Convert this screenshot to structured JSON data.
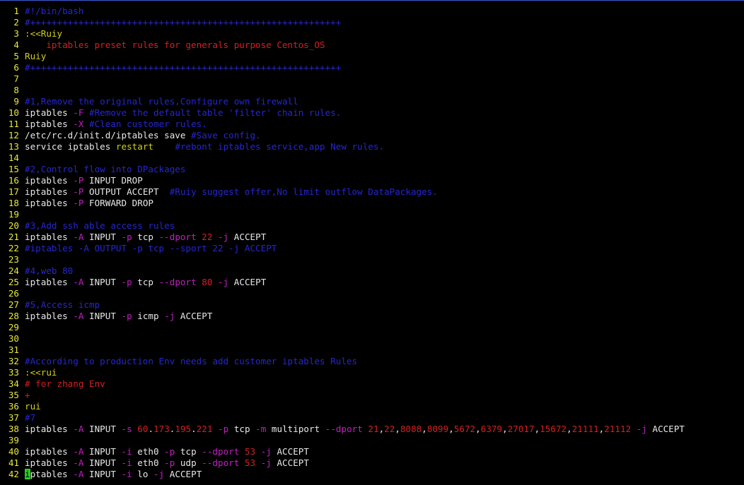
{
  "lines": [
    [
      [
        "c",
        "#!/bin/bash"
      ]
    ],
    [
      [
        "c",
        "#++++++++++++++++++++++++++++++++++++++++++++++++++++++++++"
      ]
    ],
    [
      [
        "y",
        ":<<Ruiy"
      ]
    ],
    [
      [
        "r",
        "    iptables preset rules for generals purpose Centos_OS"
      ]
    ],
    [
      [
        "y",
        "Ruiy"
      ]
    ],
    [
      [
        "c",
        "#++++++++++++++++++++++++++++++++++++++++++++++++++++++++++"
      ]
    ],
    [],
    [],
    [
      [
        "c",
        "#1,Remove the original rules,Configure own firewall"
      ]
    ],
    [
      [
        "w",
        "iptables "
      ],
      [
        "m",
        "-F"
      ],
      [
        "w",
        " "
      ],
      [
        "c",
        "#Remove the default table 'filter' chain rules."
      ]
    ],
    [
      [
        "w",
        "iptables "
      ],
      [
        "m",
        "-X"
      ],
      [
        "w",
        " "
      ],
      [
        "c",
        "#Clean customer rules."
      ]
    ],
    [
      [
        "w",
        "/etc/rc.d/init.d/iptables save "
      ],
      [
        "c",
        "#Save config."
      ]
    ],
    [
      [
        "w",
        "service iptables "
      ],
      [
        "y",
        "restart"
      ],
      [
        "w",
        "    "
      ],
      [
        "c",
        "#rebont iptables service,app New rules."
      ]
    ],
    [],
    [
      [
        "c",
        "#2,Control flow into DPackages"
      ]
    ],
    [
      [
        "w",
        "iptables "
      ],
      [
        "m",
        "-P"
      ],
      [
        "w",
        " INPUT DROP"
      ]
    ],
    [
      [
        "w",
        "iptables "
      ],
      [
        "m",
        "-P"
      ],
      [
        "w",
        " OUTPUT ACCEPT  "
      ],
      [
        "c",
        "#Ruiy suggest offer,No limit outflow DataPackages."
      ]
    ],
    [
      [
        "w",
        "iptables "
      ],
      [
        "m",
        "-P"
      ],
      [
        "w",
        " FORWARD DROP"
      ]
    ],
    [],
    [
      [
        "c",
        "#3,Add ssh able access rules"
      ]
    ],
    [
      [
        "w",
        "iptables "
      ],
      [
        "m",
        "-A"
      ],
      [
        "w",
        " INPUT "
      ],
      [
        "m",
        "-p"
      ],
      [
        "w",
        " tcp "
      ],
      [
        "m",
        "--dport"
      ],
      [
        "w",
        " "
      ],
      [
        "r",
        "22"
      ],
      [
        "w",
        " "
      ],
      [
        "m",
        "-j"
      ],
      [
        "w",
        " ACCEPT"
      ]
    ],
    [
      [
        "c",
        "#iptables -A OUTPUT -p tcp --sport 22 -j ACCEPT"
      ]
    ],
    [],
    [
      [
        "c",
        "#4,web 80"
      ]
    ],
    [
      [
        "w",
        "iptables "
      ],
      [
        "m",
        "-A"
      ],
      [
        "w",
        " INPUT "
      ],
      [
        "m",
        "-p"
      ],
      [
        "w",
        " tcp "
      ],
      [
        "m",
        "--dport"
      ],
      [
        "w",
        " "
      ],
      [
        "r",
        "80"
      ],
      [
        "w",
        " "
      ],
      [
        "m",
        "-j"
      ],
      [
        "w",
        " ACCEPT"
      ]
    ],
    [],
    [
      [
        "c",
        "#5,Access icmp"
      ]
    ],
    [
      [
        "w",
        "iptables "
      ],
      [
        "m",
        "-A"
      ],
      [
        "w",
        " INPUT "
      ],
      [
        "m",
        "-p"
      ],
      [
        "w",
        " icmp "
      ],
      [
        "m",
        "-j"
      ],
      [
        "w",
        " ACCEPT"
      ]
    ],
    [],
    [],
    [],
    [
      [
        "c",
        "#According to production Env needs add customer iptables Rules"
      ]
    ],
    [
      [
        "y",
        ":<<rui"
      ]
    ],
    [
      [
        "r",
        "# for zhang Env"
      ]
    ],
    [
      [
        "r",
        "+"
      ]
    ],
    [
      [
        "y",
        "rui"
      ]
    ],
    [
      [
        "c",
        "#7"
      ]
    ],
    [
      [
        "w",
        "iptables "
      ],
      [
        "m",
        "-A"
      ],
      [
        "w",
        " INPUT "
      ],
      [
        "m",
        "-s"
      ],
      [
        "w",
        " "
      ],
      [
        "r",
        "60"
      ],
      [
        "w",
        "."
      ],
      [
        "r",
        "173"
      ],
      [
        "w",
        "."
      ],
      [
        "r",
        "195"
      ],
      [
        "w",
        "."
      ],
      [
        "r",
        "221"
      ],
      [
        "w",
        " "
      ],
      [
        "m",
        "-p"
      ],
      [
        "w",
        " tcp "
      ],
      [
        "m",
        "-m"
      ],
      [
        "w",
        " multiport "
      ],
      [
        "m",
        "--dport"
      ],
      [
        "w",
        " "
      ],
      [
        "r",
        "21"
      ],
      [
        "w",
        ","
      ],
      [
        "r",
        "22"
      ],
      [
        "w",
        ","
      ],
      [
        "r",
        "8088"
      ],
      [
        "w",
        ","
      ],
      [
        "r",
        "8099"
      ],
      [
        "w",
        ","
      ],
      [
        "r",
        "5672"
      ],
      [
        "w",
        ","
      ],
      [
        "r",
        "6379"
      ],
      [
        "w",
        ","
      ],
      [
        "r",
        "27017"
      ],
      [
        "w",
        ","
      ],
      [
        "r",
        "15672"
      ],
      [
        "w",
        ","
      ],
      [
        "r",
        "21111"
      ],
      [
        "w",
        ","
      ],
      [
        "r",
        "21112"
      ],
      [
        "w",
        " "
      ],
      [
        "m",
        "-j"
      ],
      [
        "w",
        " ACCEPT"
      ]
    ],
    [],
    [
      [
        "w",
        "iptables "
      ],
      [
        "m",
        "-A"
      ],
      [
        "w",
        " INPUT "
      ],
      [
        "m",
        "-i"
      ],
      [
        "w",
        " eth0 "
      ],
      [
        "m",
        "-p"
      ],
      [
        "w",
        " tcp "
      ],
      [
        "m",
        "--dport"
      ],
      [
        "w",
        " "
      ],
      [
        "r",
        "53"
      ],
      [
        "w",
        " "
      ],
      [
        "m",
        "-j"
      ],
      [
        "w",
        " ACCEPT"
      ]
    ],
    [
      [
        "w",
        "iptables "
      ],
      [
        "m",
        "-A"
      ],
      [
        "w",
        " INPUT "
      ],
      [
        "m",
        "-i"
      ],
      [
        "w",
        " eth0 "
      ],
      [
        "m",
        "-p"
      ],
      [
        "w",
        " udp "
      ],
      [
        "m",
        "--dport"
      ],
      [
        "w",
        " "
      ],
      [
        "r",
        "53"
      ],
      [
        "w",
        " "
      ],
      [
        "m",
        "-j"
      ],
      [
        "w",
        " ACCEPT"
      ]
    ],
    [
      [
        "cursor",
        "i"
      ],
      [
        "w",
        "ptables "
      ],
      [
        "m",
        "-A"
      ],
      [
        "w",
        " INPUT "
      ],
      [
        "m",
        "-i"
      ],
      [
        "w",
        " lo "
      ],
      [
        "m",
        "-j"
      ],
      [
        "w",
        " ACCEPT"
      ]
    ]
  ]
}
